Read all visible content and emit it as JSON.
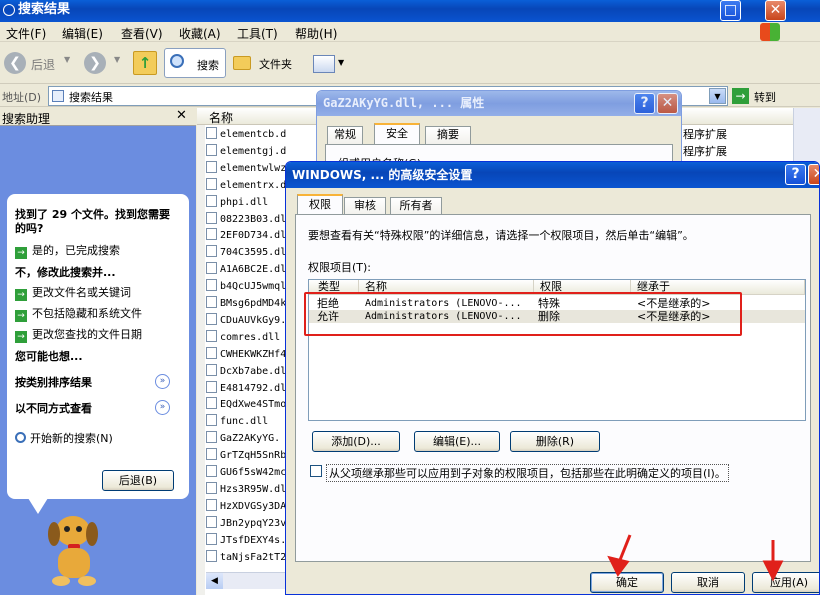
{
  "explorer": {
    "title": "搜索结果",
    "menu": [
      "文件(F)",
      "编辑(E)",
      "查看(V)",
      "收藏(A)",
      "工具(T)",
      "帮助(H)"
    ],
    "toolbar": {
      "back": "后退",
      "search": "搜索",
      "folders": "文件夹"
    },
    "address_label": "地址(D)",
    "address_value": "搜索结果",
    "go_label": "转到",
    "pane_title": "搜索助理",
    "col_name": "名称",
    "files": [
      "elementcb.dll",
      "elementgj.dll",
      "elementwlwz",
      "elementrx.d",
      "phpi.dll",
      "08223B03.dl",
      "2EF0D734.dl",
      "704C3595.dl",
      "A1A6BC2E.dl",
      "b4QcUJ5wmql",
      "BMsg6pdMD4k",
      "CDuAUVkGy9.",
      "comres.dll",
      "CWHEKWKZHf4",
      "DcXb7abe.dl",
      "E4814792.dl",
      "EQdXwe4STmo",
      "func.dll",
      "GaZ2AKyYG.",
      "GrTZqH5SnRb",
      "GU6f5sW42mc",
      "Hzs3R95W.dl",
      "HzXDVGSy3DA",
      "JBn2ypqY23v",
      "JTsfDEXY4s.",
      "taNjsFa2tT2"
    ],
    "right_col": [
      "程序扩展",
      "程序扩展"
    ]
  },
  "assistant": {
    "found_text": "找到了 29 个文件。找到您需要的吗?",
    "yes_done": "是的，已完成搜索",
    "refine_header": "不，修改此搜索并...",
    "refine_items": [
      "更改文件名或关键词",
      "不包括隐藏和系统文件",
      "更改您查找的文件日期"
    ],
    "maybe_header": "您可能也想...",
    "sort_by": "按类别排序结果",
    "view_diff": "以不同方式查看",
    "new_search": "开始新的搜索(N)",
    "back_button": "后退(B)"
  },
  "properties": {
    "title": "GaZ2AKyYG.dll, ... 属性",
    "tabs": [
      "常规",
      "安全",
      "摘要"
    ],
    "group_label": "组或用户名称(G):"
  },
  "advanced": {
    "title": "WINDOWS, ... 的高级安全设置",
    "tabs": [
      "权限",
      "审核",
      "所有者"
    ],
    "instruction": "要想查看有关“特殊权限”的详细信息，请选择一个权限项目，然后单击“编辑”。",
    "list_label": "权限项目(T):",
    "headers": [
      "类型",
      "名称",
      "权限",
      "继承于"
    ],
    "rows": [
      {
        "type": "拒绝",
        "name": "Administrators (LENOVO-...",
        "perm": "特殊",
        "inherit": "<不是继承的>"
      },
      {
        "type": "允许",
        "name": "Administrators (LENOVO-...",
        "perm": "删除",
        "inherit": "<不是继承的>"
      }
    ],
    "add_button": "添加(D)...",
    "edit_button": "编辑(E)...",
    "remove_button": "删除(R)",
    "inherit_checkbox": "从父项继承那些可以应用到子对象的权限项目，包括那些在此明确定义的项目(I)。",
    "ok_button": "确定",
    "cancel_button": "取消",
    "apply_button": "应用(A)"
  },
  "colors": {
    "xp_blue": "#0a54d0",
    "pane_blue": "#6b8de0",
    "annotation_red": "#e0201a"
  }
}
